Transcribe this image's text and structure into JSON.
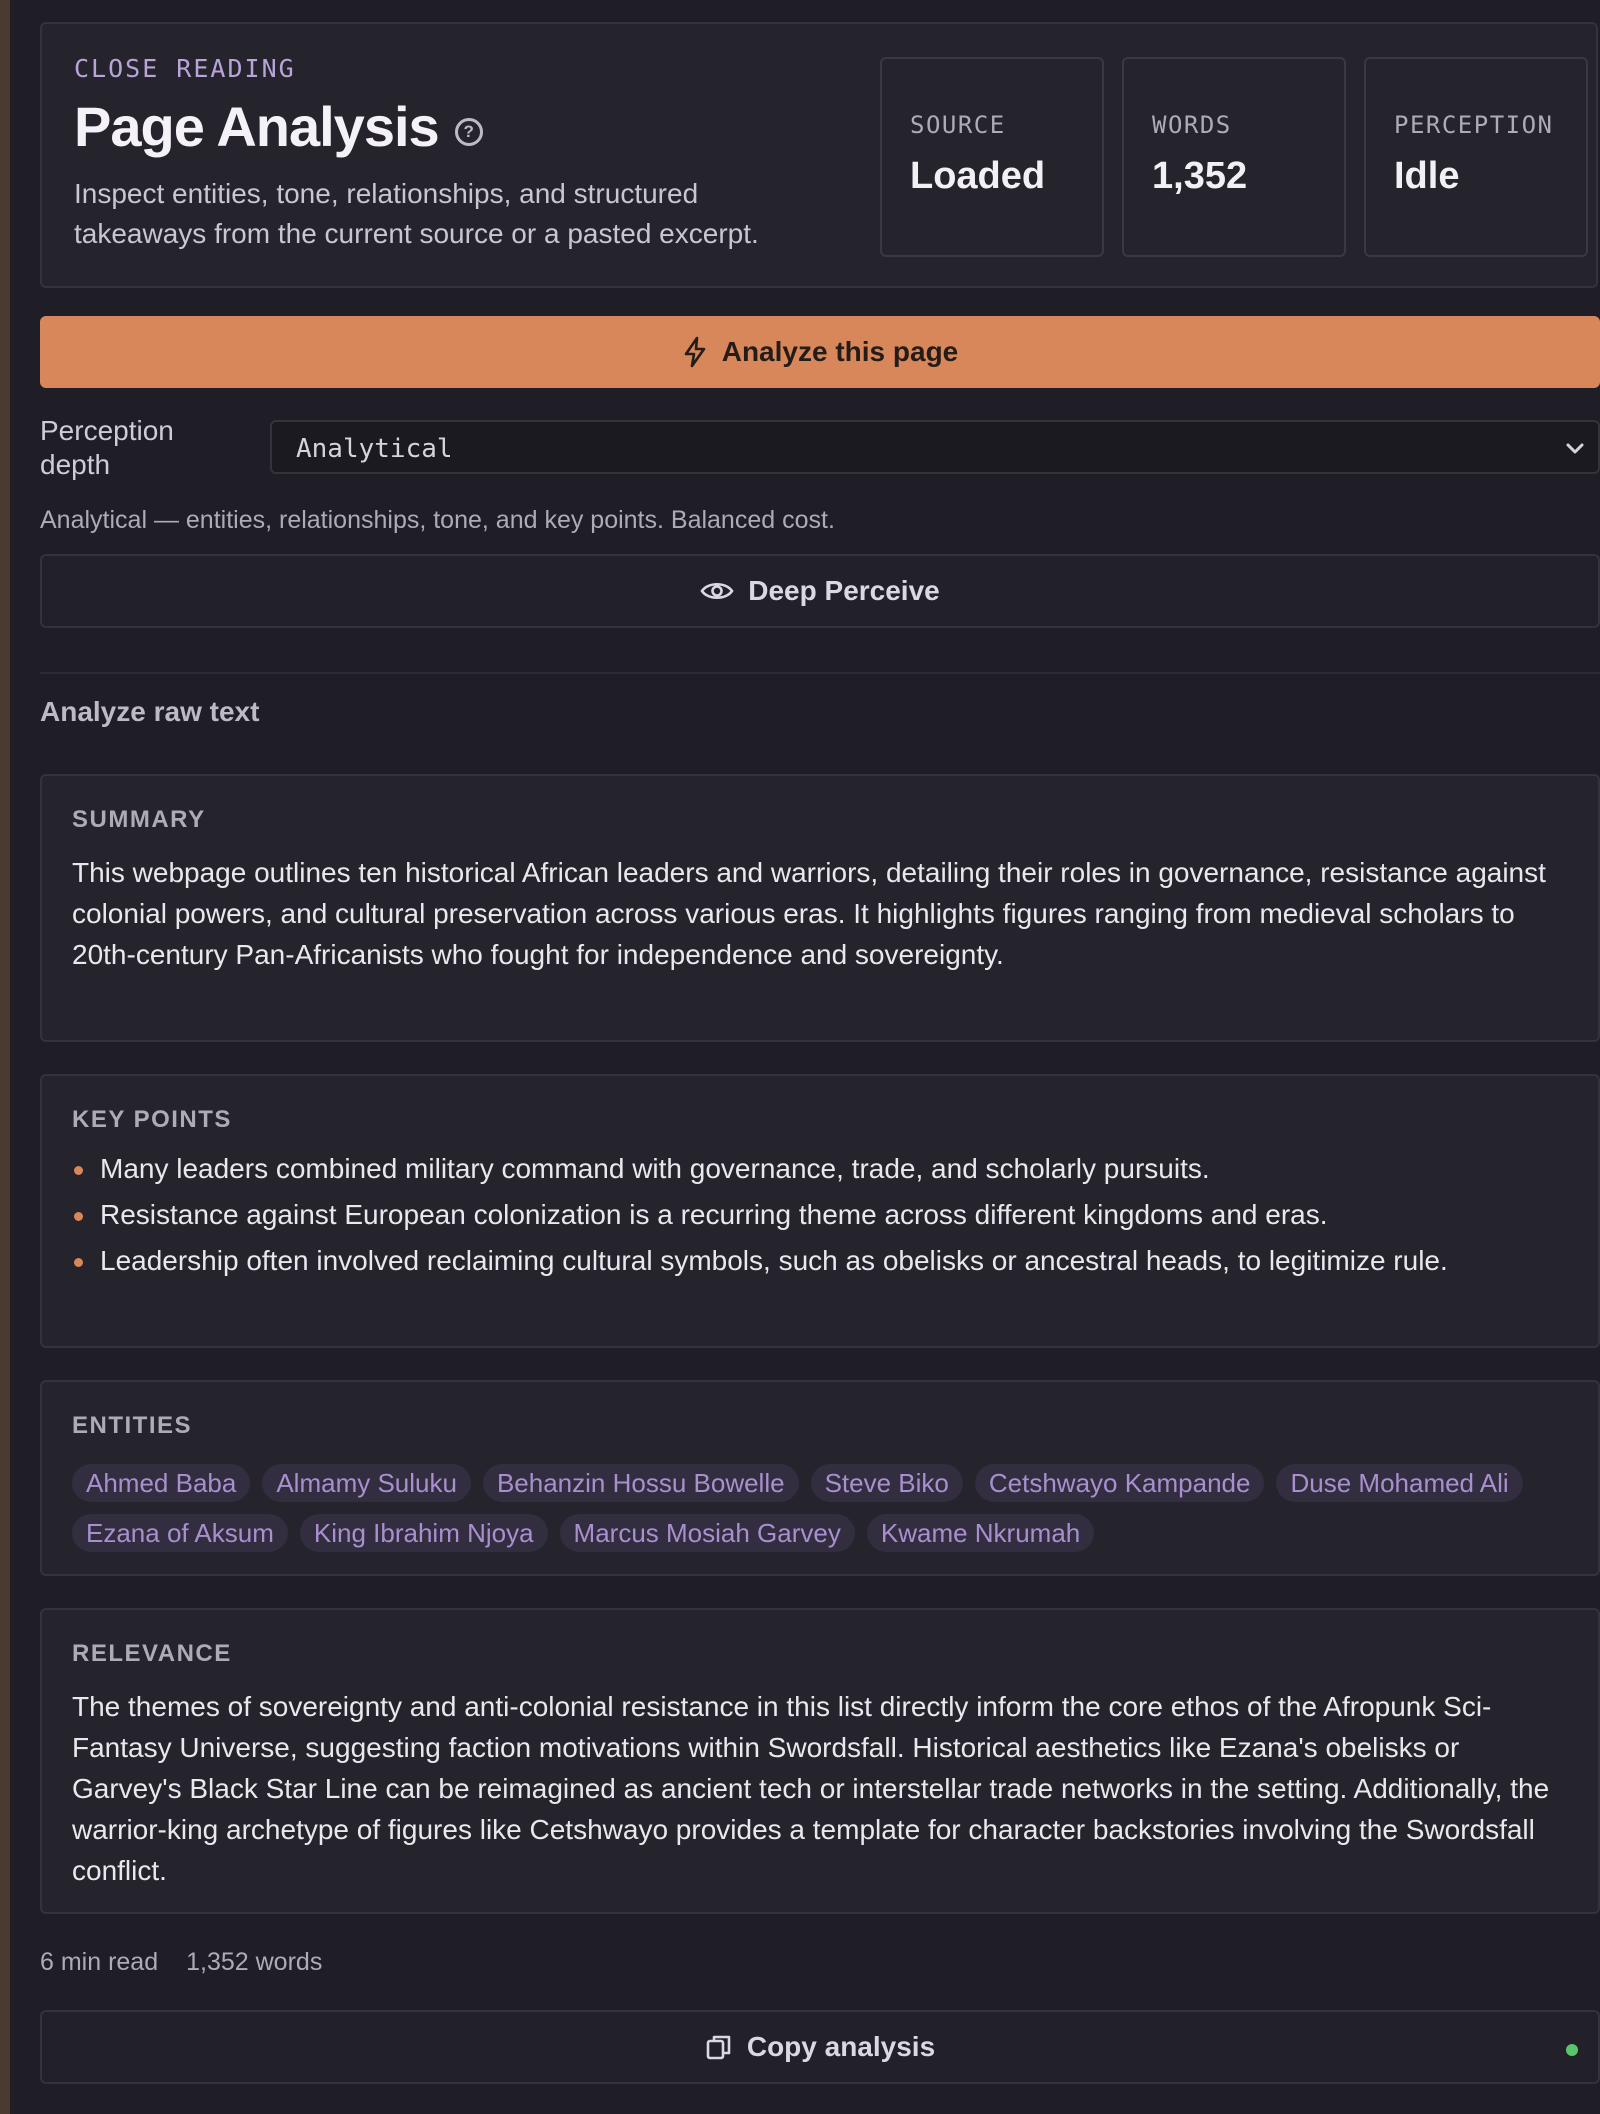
{
  "header": {
    "eyebrow": "CLOSE READING",
    "title": "Page Analysis",
    "subtitle": "Inspect entities, tone, relationships, and structured takeaways from the current source or a pasted excerpt.",
    "stats": [
      {
        "label": "SOURCE",
        "value": "Loaded"
      },
      {
        "label": "WORDS",
        "value": "1,352"
      },
      {
        "label": "PERCEPTION",
        "value": "Idle"
      }
    ]
  },
  "actions": {
    "analyze_label": "Analyze this page",
    "deep_label": "Deep Perceive",
    "raw_label": "Analyze raw text",
    "copy_label": "Copy analysis"
  },
  "depth": {
    "label": "Perception depth",
    "selected": "Analytical",
    "help": "Analytical — entities, relationships, tone, and key points. Balanced cost."
  },
  "summary": {
    "title": "SUMMARY",
    "text": "This webpage outlines ten historical African leaders and warriors, detailing their roles in governance, resistance against colonial powers, and cultural preservation across various eras. It highlights figures ranging from medieval scholars to 20th-century Pan-Africanists who fought for independence and sovereignty."
  },
  "key_points": {
    "title": "KEY POINTS",
    "items": [
      "Many leaders combined military command with governance, trade, and scholarly pursuits.",
      "Resistance against European colonization is a recurring theme across different kingdoms and eras.",
      "Leadership often involved reclaiming cultural symbols, such as obelisks or ancestral heads, to legitimize rule."
    ]
  },
  "entities": {
    "title": "ENTITIES",
    "items": [
      "Ahmed Baba",
      "Almamy Suluku",
      "Behanzin Hossu Bowelle",
      "Steve Biko",
      "Cetshwayo Kampande",
      "Duse Mohamed Ali",
      "Ezana of Aksum",
      "King Ibrahim Njoya",
      "Marcus Mosiah Garvey",
      "Kwame Nkrumah"
    ]
  },
  "relevance": {
    "title": "RELEVANCE",
    "text": "The themes of sovereignty and anti-colonial resistance in this list directly inform the core ethos of the Afropunk Sci-Fantasy Universe, suggesting faction motivations within Swordsfall. Historical aesthetics like Ezana's obelisks or Garvey's Black Star Line can be reimagined as ancient tech or interstellar trade networks in the setting. Additionally, the warrior-king archetype of figures like Cetshwayo provides a template for character backstories involving the Swordsfall conflict."
  },
  "meta": {
    "read_time": "6 min read",
    "word_count": "1,352 words"
  },
  "colors": {
    "accent": "#d8875a",
    "chip_text": "#a890cf",
    "status_dot": "#59c46a"
  }
}
